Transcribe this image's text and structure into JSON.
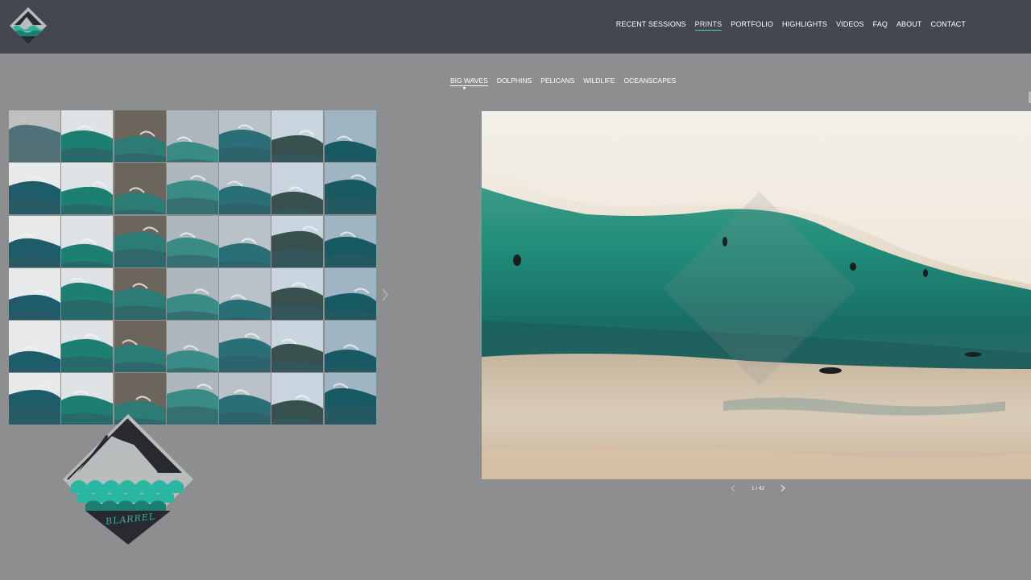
{
  "nav": {
    "items": [
      {
        "label": "RECENT SESSIONS",
        "active": false
      },
      {
        "label": "PRINTS",
        "active": true
      },
      {
        "label": "PORTFOLIO",
        "active": false
      },
      {
        "label": "HIGHLIGHTS",
        "active": false
      },
      {
        "label": "VIDEOS",
        "active": false
      },
      {
        "label": "FAQ",
        "active": false
      },
      {
        "label": "ABOUT",
        "active": false
      },
      {
        "label": "CONTACT",
        "active": false
      }
    ]
  },
  "categories": {
    "items": [
      {
        "label": "BIG WAVES",
        "active": true
      },
      {
        "label": "DOLPHINS",
        "active": false
      },
      {
        "label": "PELICANS",
        "active": false
      },
      {
        "label": "WILDLIFE",
        "active": false
      },
      {
        "label": "OCEANSCAPES",
        "active": false
      }
    ]
  },
  "viewer": {
    "counter": "1 / 42"
  },
  "logo": {
    "text": "BLARREL"
  },
  "colors": {
    "header_bg": "#44474f",
    "page_bg": "#8d8e8f",
    "accent_teal": "#2ab7a2",
    "active_underline": "#56c8c0"
  },
  "icons": {
    "logo": "wave-diamond-logo-icon",
    "prev": "chevron-left-icon",
    "next": "chevron-right-icon"
  }
}
